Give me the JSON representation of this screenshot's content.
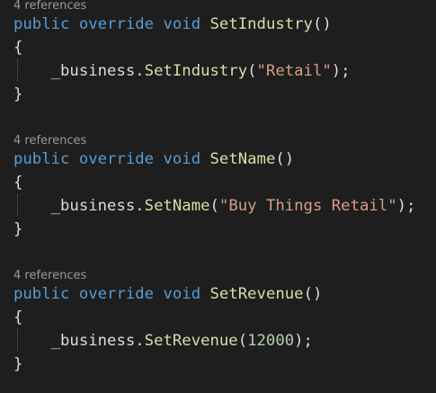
{
  "colors": {
    "background": "#1e1e1e",
    "keyword": "#569cd6",
    "method": "#dcdcaa",
    "string": "#d69d85",
    "number": "#b5cea8",
    "plain": "#dcdcdc",
    "codelens": "#999999"
  },
  "blocks": [
    {
      "codelens": "4 references",
      "kw_public": "public",
      "kw_override": "override",
      "kw_void": "void",
      "method_name": "SetIndustry",
      "params": "()",
      "open_brace": "{",
      "call_target": "_business.",
      "call_method": "SetIndustry",
      "call_open": "(",
      "arg": "\"Retail\"",
      "call_close": ");",
      "close_brace": "}"
    },
    {
      "codelens": "4 references",
      "kw_public": "public",
      "kw_override": "override",
      "kw_void": "void",
      "method_name": "SetName",
      "params": "()",
      "open_brace": "{",
      "call_target": "_business.",
      "call_method": "SetName",
      "call_open": "(",
      "arg": "\"Buy Things Retail\"",
      "call_close": ");",
      "close_brace": "}"
    },
    {
      "codelens": "4 references",
      "kw_public": "public",
      "kw_override": "override",
      "kw_void": "void",
      "method_name": "SetRevenue",
      "params": "()",
      "open_brace": "{",
      "call_target": "_business.",
      "call_method": "SetRevenue",
      "call_open": "(",
      "arg": "12000",
      "call_close": ");",
      "close_brace": "}"
    }
  ]
}
